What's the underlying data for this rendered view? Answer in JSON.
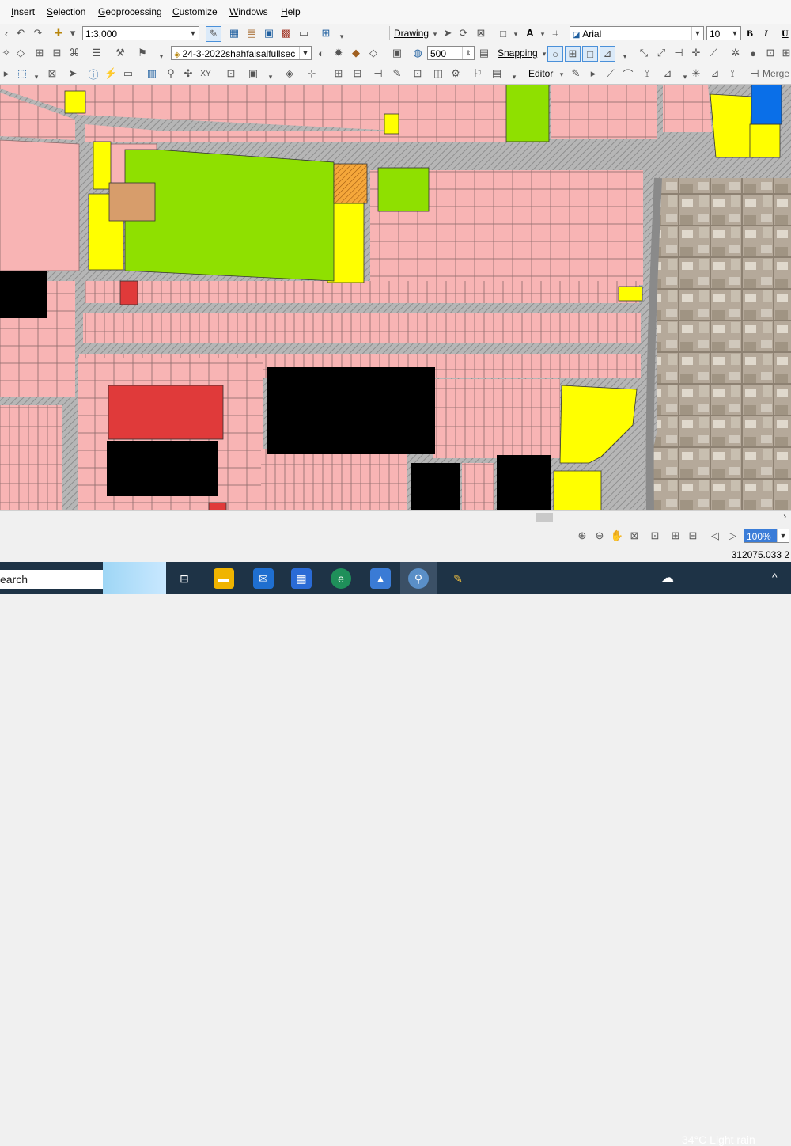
{
  "menu": {
    "items": [
      "Insert",
      "Selection",
      "Geoprocessing",
      "Customize",
      "Windows",
      "Help"
    ]
  },
  "toolbar1": {
    "scale": "1:3,000",
    "drawing_label": "Drawing",
    "font_name": "Arial",
    "font_size": "10",
    "bold": "B",
    "italic": "I",
    "underline": "U"
  },
  "toolbar2": {
    "layer_name": "24-3-2022shahfaisalfullsec",
    "buffer_value": "500",
    "snapping_label": "Snapping"
  },
  "toolbar3": {
    "editor_label": "Editor",
    "merge_label": "Merge"
  },
  "statusnav": {
    "zoom_value": "100%"
  },
  "statusbar": {
    "coordinates": "312075.033  2"
  },
  "taskbar": {
    "search_text": "earch",
    "weather": "34°C  Light rain",
    "chevron": "^"
  },
  "colors": {
    "parcel": "#f8b4b4",
    "road": "#b2b2b2",
    "park": "#8fe000",
    "yellow": "#ffff00",
    "black": "#000000",
    "red": "#e03a3a",
    "brown": "#d79d6b",
    "orange": "#f5a73a",
    "blue": "#0a6fe8"
  }
}
